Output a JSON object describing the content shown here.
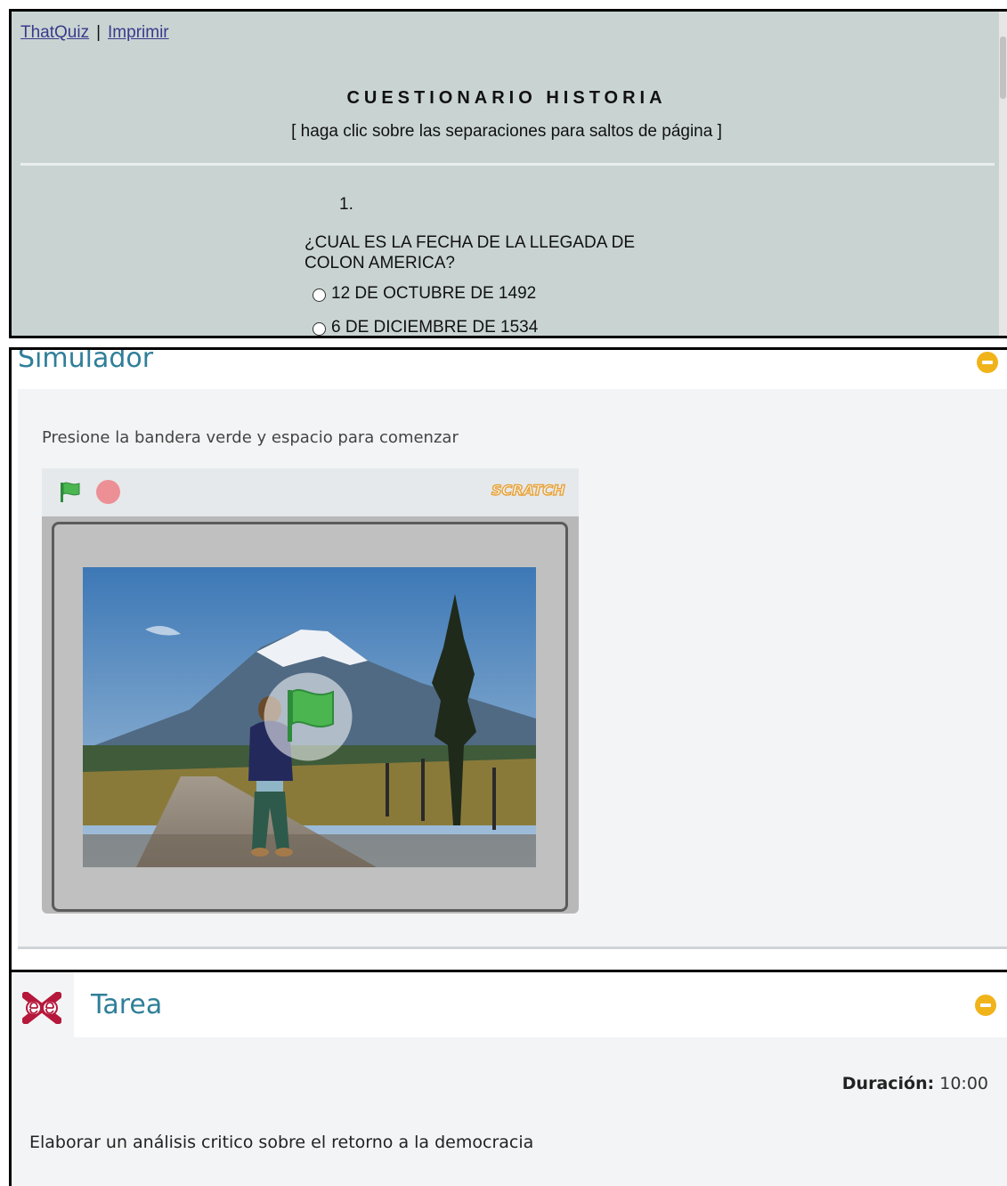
{
  "quiz": {
    "links": {
      "home": "ThatQuiz",
      "separator": "|",
      "print": "Imprimir"
    },
    "title": "CUESTIONARIO HISTORIA",
    "hint": "[ haga clic sobre las separaciones para saltos de página ]",
    "question": {
      "number": "1.",
      "text": "¿CUAL ES LA FECHA DE LA LLEGADA DE COLON AMERICA?",
      "options": [
        "12 DE OCTUBRE DE 1492",
        "6 DE DICIEMBRE DE 1534"
      ]
    }
  },
  "simulator": {
    "title": "Simulador",
    "instruction": "Presione la bandera verde y espacio para comenzar",
    "brand": "SCRATCH",
    "icons": {
      "start": "green-flag-icon",
      "stop": "stop-icon",
      "collapse": "minus-circle-icon"
    }
  },
  "task": {
    "title": "Tarea",
    "duration_label": "Duración:",
    "duration_value": "10:00",
    "description": "Elaborar un análisis critico sobre el retorno a la democracia",
    "icons": {
      "logo": "exe-logo-icon",
      "collapse": "minus-circle-icon"
    }
  },
  "colors": {
    "accent_title": "#2f7f99",
    "collapse_button": "#f0b41a",
    "quiz_bg": "#c9d4d2"
  }
}
